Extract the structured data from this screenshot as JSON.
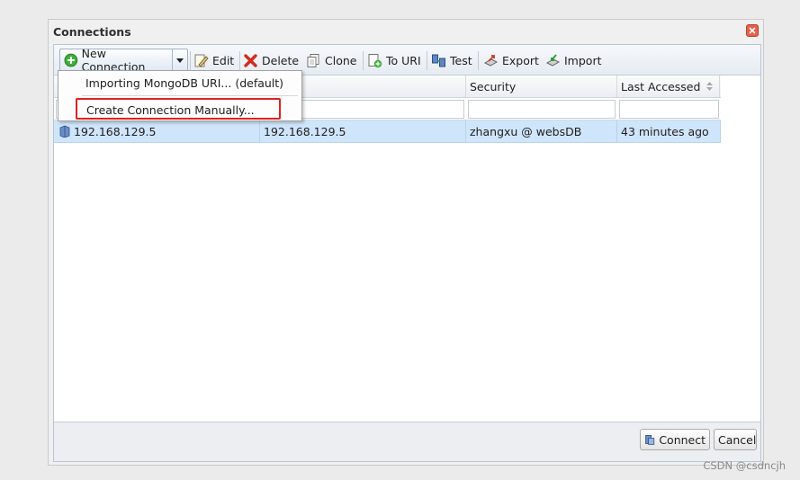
{
  "dialog": {
    "title": "Connections"
  },
  "toolbar": {
    "new_connection": "New Connection",
    "edit": "Edit",
    "delete": "Delete",
    "clone": "Clone",
    "to_uri": "To URI",
    "test": "Test",
    "export": "Export",
    "import": "Import"
  },
  "dropdown": {
    "items": [
      "Importing MongoDB URI... (default)",
      "Create Connection Manually..."
    ]
  },
  "grid": {
    "columns": [
      "",
      "",
      "Security",
      "Last Accessed"
    ],
    "rows": [
      {
        "name": "192.168.129.5",
        "server": "192.168.129.5",
        "security": "zhangxu @ websDB",
        "last_accessed": "43 minutes ago"
      }
    ]
  },
  "footer": {
    "connect": "Connect",
    "cancel": "Cancel"
  },
  "watermark": "CSDN @csdncjh",
  "colors": {
    "highlight": "#e02020",
    "selected_row": "#cfe5fb",
    "close": "#e8604c"
  }
}
